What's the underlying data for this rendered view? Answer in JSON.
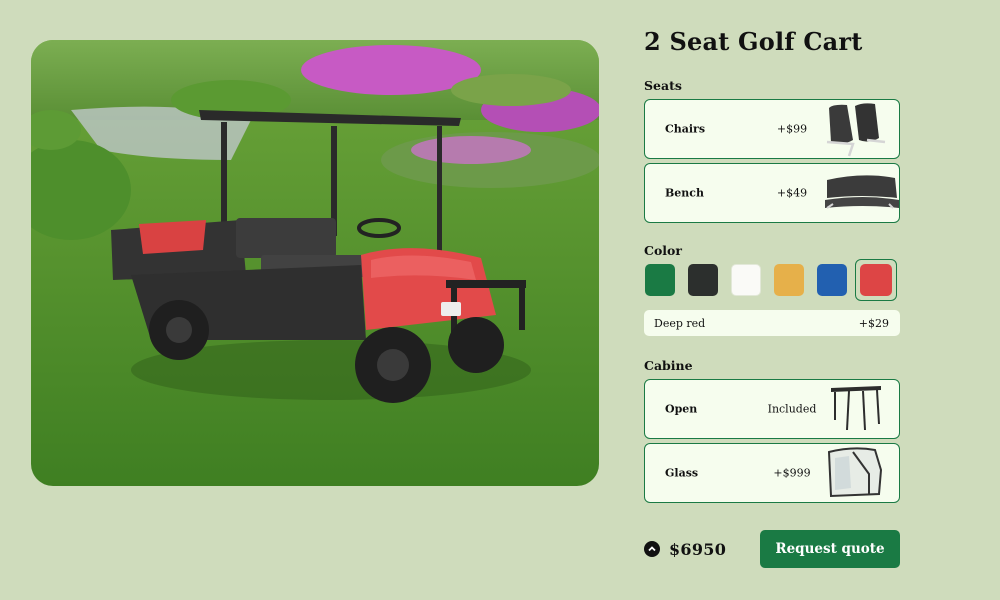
{
  "product": {
    "title": "2 Seat Golf Cart",
    "image_alt": "Golf cart on lawn"
  },
  "seats": {
    "label": "Seats",
    "options": [
      {
        "name": "Chairs",
        "price": "+$99",
        "selected": true
      },
      {
        "name": "Bench",
        "price": "+$49",
        "selected": false
      }
    ]
  },
  "color": {
    "label": "Color",
    "swatches": [
      {
        "name": "green",
        "hex": "#1a7a44"
      },
      {
        "name": "black",
        "hex": "#2c2f2d"
      },
      {
        "name": "white",
        "hex": "#fafaf7"
      },
      {
        "name": "yellow",
        "hex": "#e6b04a"
      },
      {
        "name": "blue",
        "hex": "#2260b0"
      },
      {
        "name": "deep-red",
        "hex": "#dd4545",
        "selected": true
      }
    ],
    "selected_name": "Deep red",
    "selected_price": "+$29"
  },
  "cabine": {
    "label": "Cabine",
    "options": [
      {
        "name": "Open",
        "price": "Included",
        "selected": true
      },
      {
        "name": "Glass",
        "price": "+$999",
        "selected": false
      }
    ]
  },
  "footer": {
    "total": "$6950",
    "cta": "Request quote"
  },
  "colors": {
    "background": "#cfdcbc",
    "accent": "#1a7a44",
    "card": "#f6fdee"
  }
}
